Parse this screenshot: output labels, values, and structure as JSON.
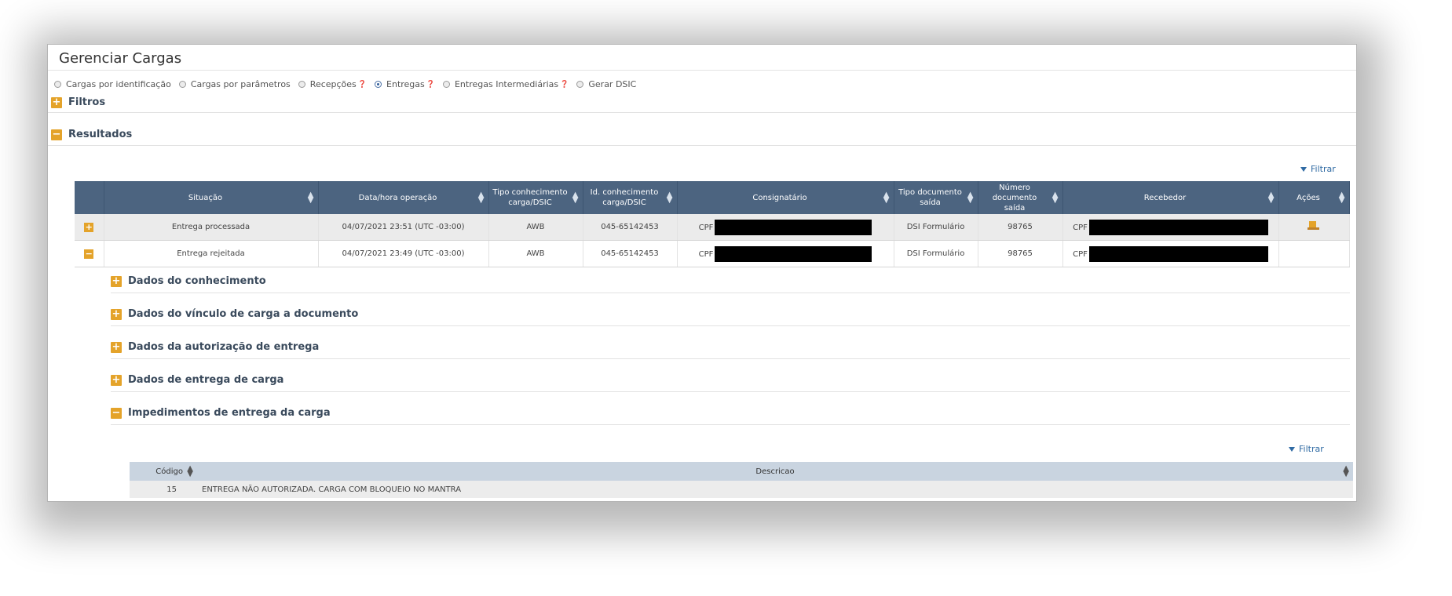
{
  "window": {
    "title": "Gerenciar Cargas"
  },
  "radio_options": [
    {
      "label": "Cargas por identificação",
      "info": false,
      "selected": false
    },
    {
      "label": "Cargas por parâmetros",
      "info": false,
      "selected": false
    },
    {
      "label": "Recepções",
      "info": true,
      "selected": false
    },
    {
      "label": "Entregas",
      "info": true,
      "selected": true
    },
    {
      "label": "Entregas Intermediárias",
      "info": true,
      "selected": false
    },
    {
      "label": "Gerar DSIC",
      "info": false,
      "selected": false
    }
  ],
  "sections": {
    "filtros": "Filtros",
    "resultados": "Resultados"
  },
  "filtrar_label": "Filtrar",
  "table": {
    "headers": [
      "Situação",
      "Data/hora operação",
      "Tipo conhecimento carga/DSIC",
      "Id. conhecimento carga/DSIC",
      "Consignatário",
      "Tipo documento saída",
      "Número documento saída",
      "Recebedor",
      "Ações"
    ],
    "rows": [
      {
        "situacao": "Entrega processada",
        "data_hora": "04/07/2021 23:51 (UTC -03:00)",
        "tipo": "AWB",
        "id": "045-65142453",
        "consignatario_prefix": "CPF",
        "tipo_doc": "DSI Formulário",
        "numero_doc": "98765",
        "recebedor_prefix": "CPF"
      },
      {
        "situacao": "Entrega rejeitada",
        "data_hora": "04/07/2021 23:49 (UTC -03:00)",
        "tipo": "AWB",
        "id": "045-65142453",
        "consignatario_prefix": "CPF",
        "tipo_doc": "DSI Formulário",
        "numero_doc": "98765",
        "recebedor_prefix": "CPF"
      }
    ]
  },
  "details": {
    "dados_conhecimento": "Dados do conhecimento",
    "dados_vinculo": "Dados do vínculo de carga a documento",
    "dados_autorizacao": "Dados da autorização de entrega",
    "dados_entrega": "Dados de entrega de carga",
    "impedimentos": "Impedimentos de entrega da carga"
  },
  "impedimentos_table": {
    "headers": [
      "Código",
      "Descricao"
    ],
    "rows": [
      {
        "codigo": "15",
        "descricao": "ENTREGA NÃO AUTORIZADA. CARGA COM BLOQUEIO NO MANTRA"
      }
    ]
  }
}
